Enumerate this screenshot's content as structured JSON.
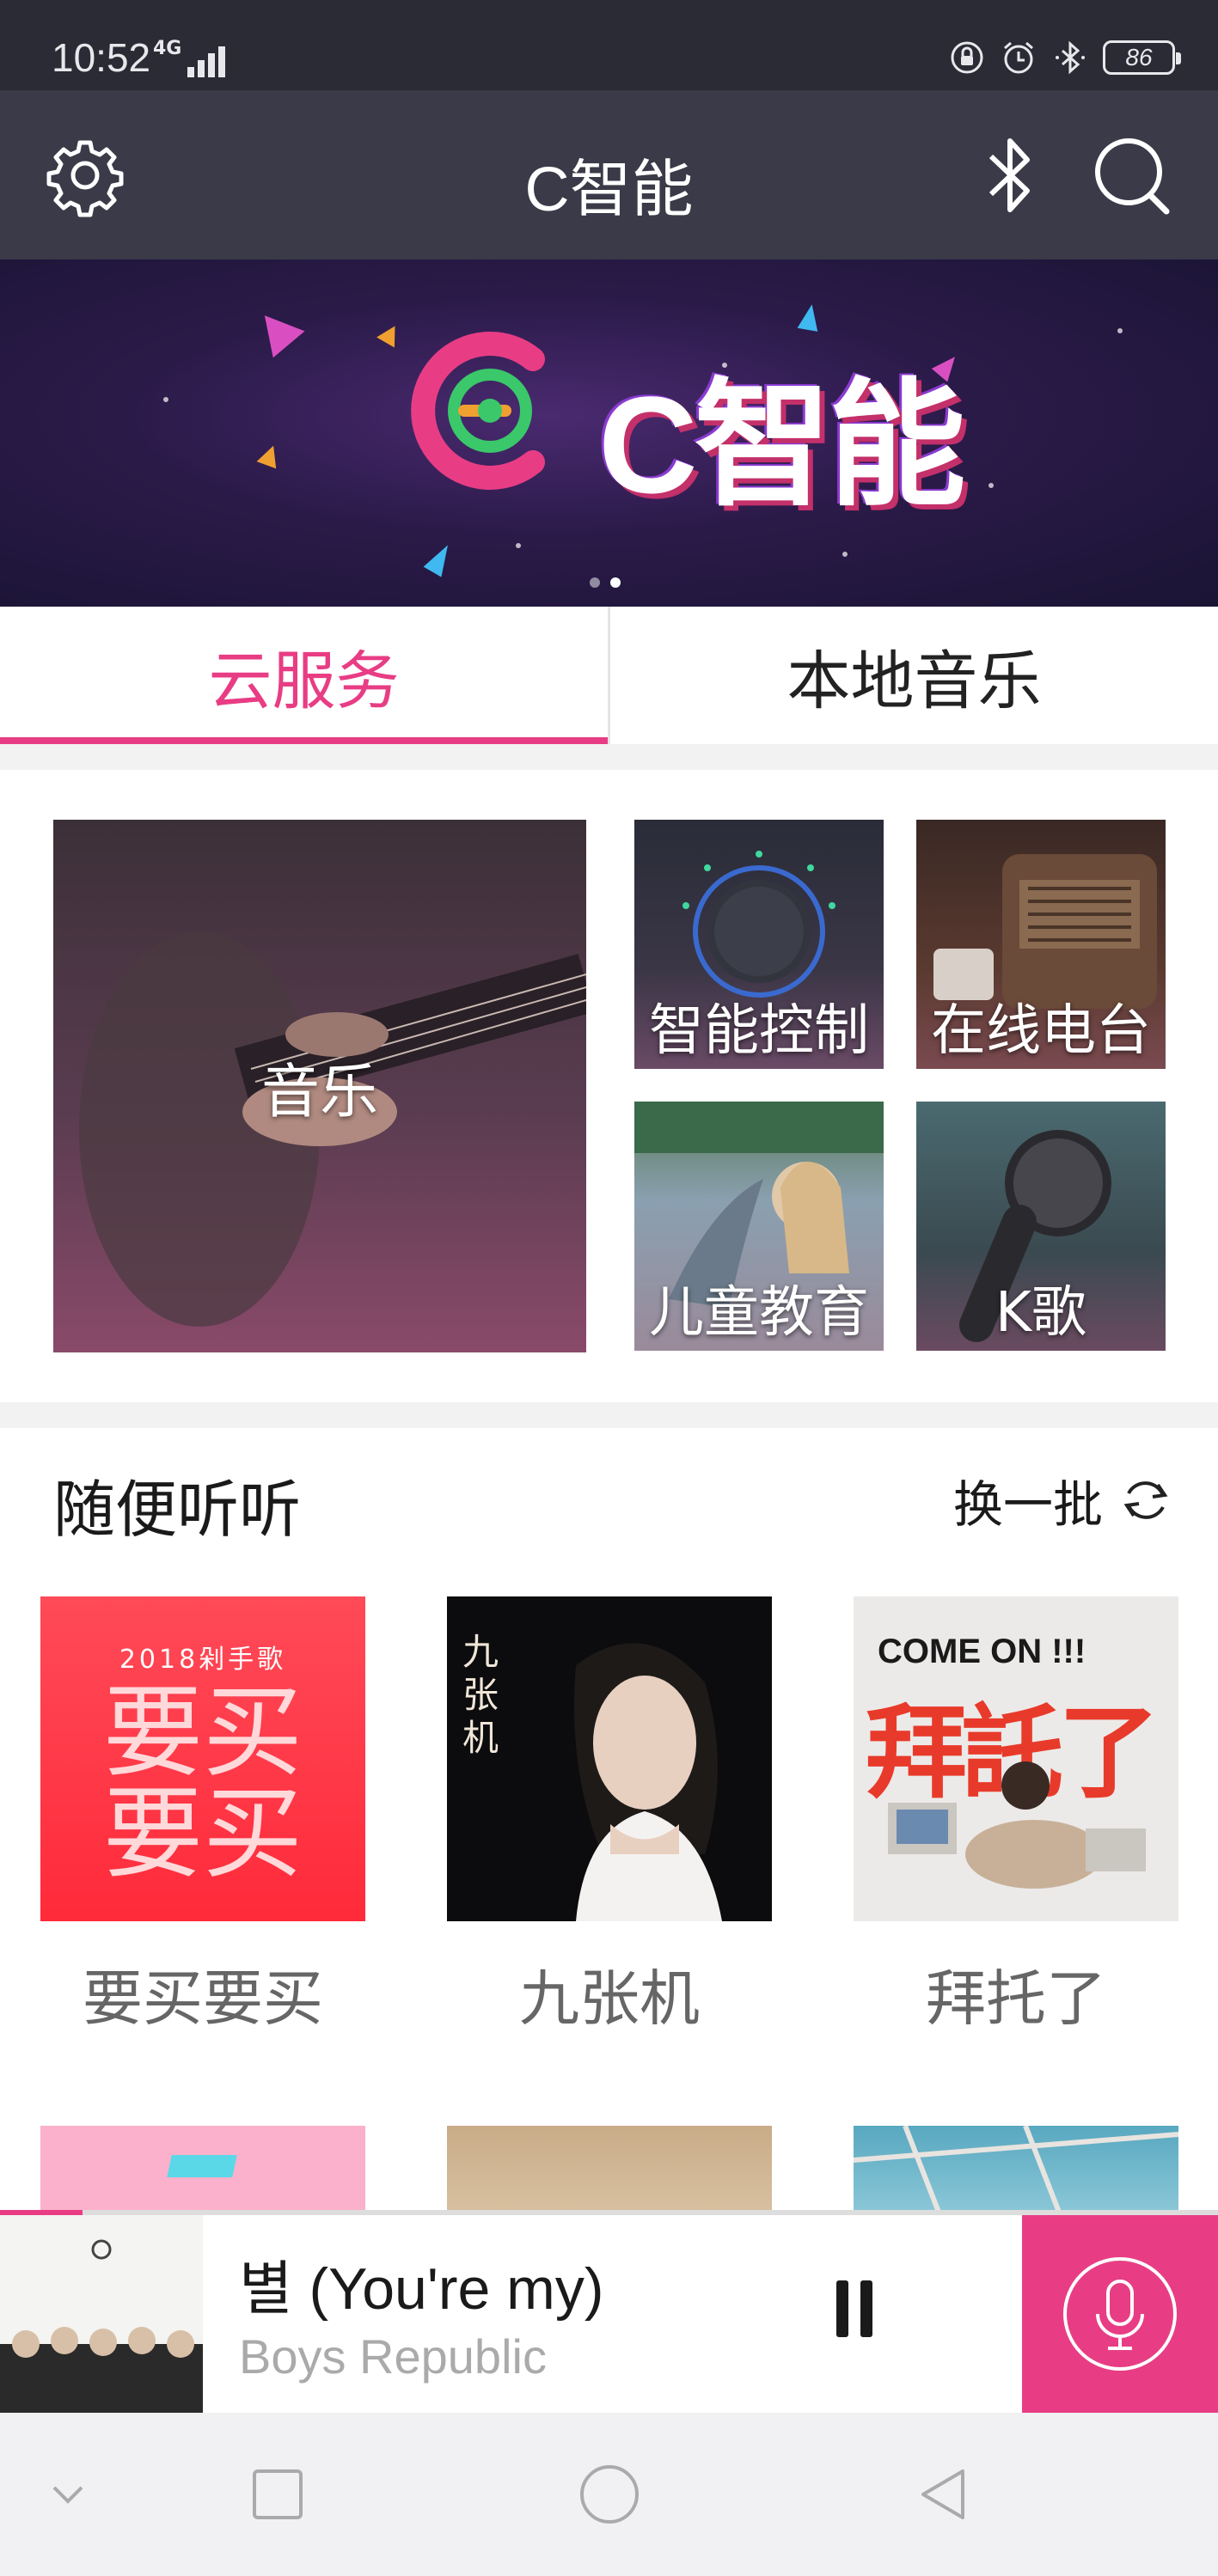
{
  "status_bar": {
    "time": "10:52",
    "network": "4G",
    "battery": "86"
  },
  "header": {
    "title": "C智能",
    "icons": [
      "gear-icon",
      "bluetooth-icon",
      "search-icon"
    ]
  },
  "banner": {
    "text": "C智能",
    "page_count": 2,
    "active_page": 2
  },
  "tabs": [
    {
      "label": "云服务",
      "active": true
    },
    {
      "label": "本地音乐",
      "active": false
    }
  ],
  "categories": [
    {
      "label": "音乐"
    },
    {
      "label": "智能控制"
    },
    {
      "label": "在线电台"
    },
    {
      "label": "儿童教育"
    },
    {
      "label": "K歌"
    }
  ],
  "random_listen": {
    "title": "随便听听",
    "refresh_label": "换一批",
    "albums": [
      {
        "name": "要买要买",
        "cover_text_top": "2018剁手歌",
        "cover_text_main": "要买要买"
      },
      {
        "name": "九张机",
        "cover_text_main": "九张机"
      },
      {
        "name": "拜托了",
        "cover_text_top": "COME ON !!!",
        "cover_text_main": "拜託了"
      }
    ]
  },
  "player": {
    "song_title": "별 (You're my)",
    "artist": "Boys Republic",
    "progress": 0.068,
    "accent_color": "#e83d84"
  },
  "navbar": {
    "icons": [
      "chevron-down-icon",
      "recent-apps-icon",
      "home-icon",
      "back-icon"
    ]
  }
}
